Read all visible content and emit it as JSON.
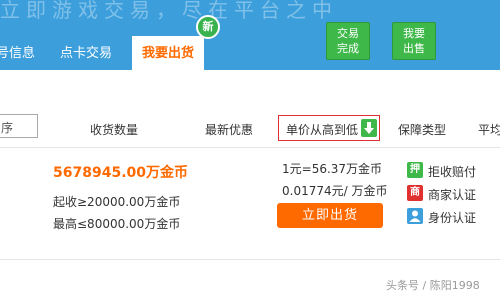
{
  "banner": {
    "text": "立即游戏交易，尽在平台之中"
  },
  "nav": {
    "tabs": [
      {
        "label": "号信息"
      },
      {
        "label": "点卡交易"
      },
      {
        "label": "我要出货"
      }
    ],
    "new_badge": "新",
    "buttons": [
      {
        "line1": "交易",
        "line2": "完成"
      },
      {
        "line1": "我要",
        "line2": "出售"
      }
    ]
  },
  "filters": {
    "sort_box": "序",
    "quantity": "收货数量",
    "latest_discount": "最新优惠",
    "price_sort": "单价从高到低",
    "guarantee_type": "保障类型",
    "platform": "平均"
  },
  "listing": {
    "amount": "5678945.00万金币",
    "min_buy": "起收≥20000.00万金币",
    "max_buy": "最高≤80000.00万金币",
    "rate1": "1元=56.37万金币",
    "rate2": "0.01774元/ 万金币",
    "sell_button": "立即出货",
    "guarantees": [
      {
        "icon_text": "押",
        "label": "拒收赔付",
        "color": "#3fb84a"
      },
      {
        "icon_text": "商",
        "label": "商家认证",
        "color": "#e03030"
      },
      {
        "icon_text": "",
        "label": "身份认证",
        "color": "#3c9fdc"
      }
    ]
  },
  "watermark": "头条号 / 陈阳1998",
  "colors": {
    "nav_blue": "#3c9fdc",
    "accent_orange": "#ff6a00",
    "green": "#3fb84a",
    "red_border": "#e03030"
  }
}
